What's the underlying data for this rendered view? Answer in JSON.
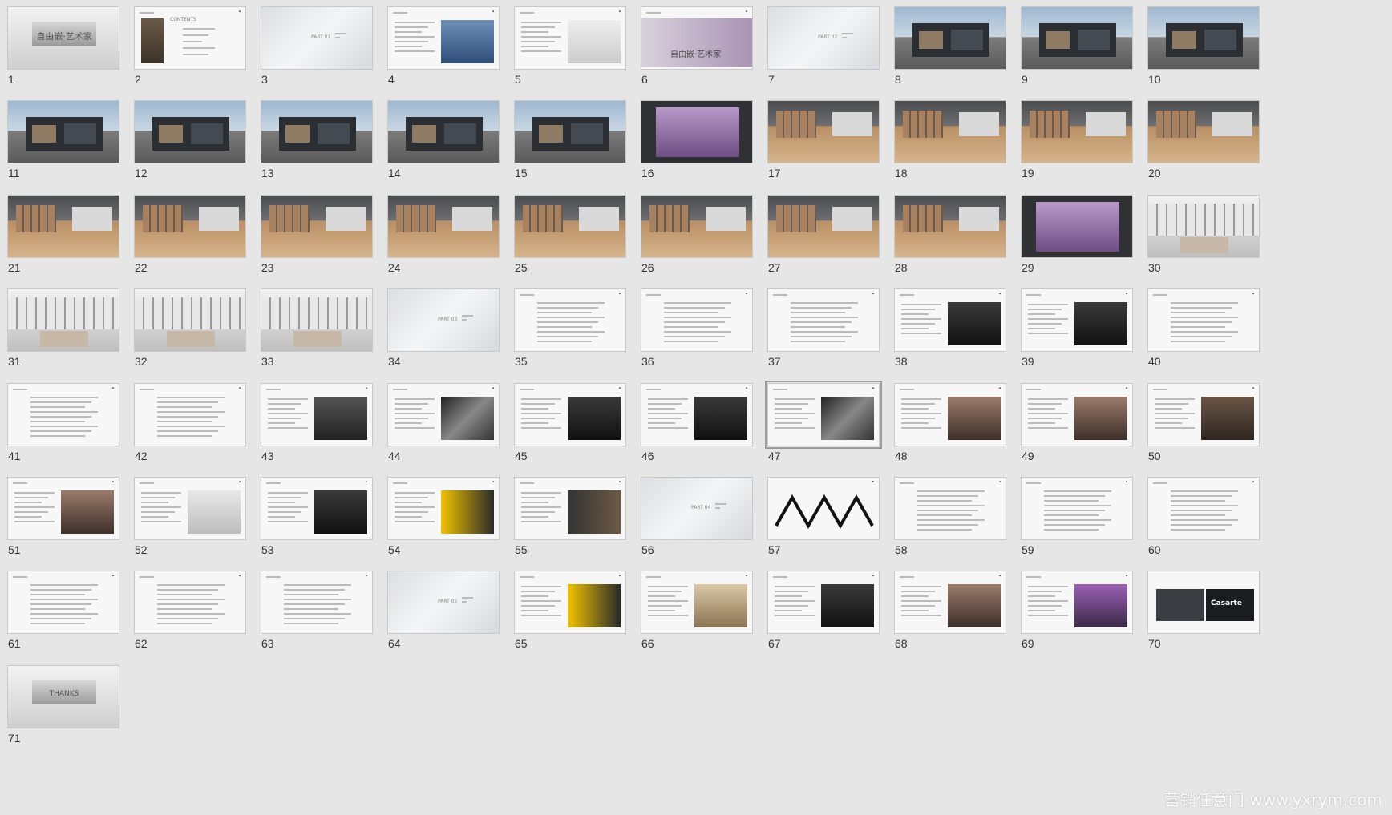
{
  "watermark": "营销任意门 www.yxrym.com",
  "colors": {
    "background": "#e6e6e6",
    "thumb_border": "#c8c8c8",
    "selected_border": "#9b9b9b"
  },
  "selected_slide": 47,
  "slides": [
    {
      "n": "1",
      "kind": "cover",
      "title": "自由嵌·艺术家"
    },
    {
      "n": "2",
      "kind": "contents",
      "title": "CONTENTS"
    },
    {
      "n": "3",
      "kind": "section",
      "title": "PART 01"
    },
    {
      "n": "4",
      "kind": "text-photo",
      "photo": "city"
    },
    {
      "n": "5",
      "kind": "text-photo",
      "photo": "plan"
    },
    {
      "n": "6",
      "kind": "banner",
      "title": "自由嵌·艺术家"
    },
    {
      "n": "7",
      "kind": "section",
      "title": "PART 02"
    },
    {
      "n": "8",
      "kind": "render",
      "scene": "dark"
    },
    {
      "n": "9",
      "kind": "render",
      "scene": "dark"
    },
    {
      "n": "10",
      "kind": "render",
      "scene": "dark"
    },
    {
      "n": "11",
      "kind": "render",
      "scene": "dark"
    },
    {
      "n": "12",
      "kind": "render",
      "scene": "dark"
    },
    {
      "n": "13",
      "kind": "render",
      "scene": "dark"
    },
    {
      "n": "14",
      "kind": "render",
      "scene": "dark"
    },
    {
      "n": "15",
      "kind": "render",
      "scene": "dark"
    },
    {
      "n": "16",
      "kind": "render",
      "scene": "purple"
    },
    {
      "n": "17",
      "kind": "render",
      "scene": "interior"
    },
    {
      "n": "18",
      "kind": "render",
      "scene": "interior"
    },
    {
      "n": "19",
      "kind": "render",
      "scene": "interior"
    },
    {
      "n": "20",
      "kind": "render",
      "scene": "interior"
    },
    {
      "n": "21",
      "kind": "render",
      "scene": "interior"
    },
    {
      "n": "22",
      "kind": "render",
      "scene": "interior"
    },
    {
      "n": "23",
      "kind": "render",
      "scene": "interior"
    },
    {
      "n": "24",
      "kind": "render",
      "scene": "interior"
    },
    {
      "n": "25",
      "kind": "render",
      "scene": "interior"
    },
    {
      "n": "26",
      "kind": "render",
      "scene": "interior"
    },
    {
      "n": "27",
      "kind": "render",
      "scene": "interior"
    },
    {
      "n": "28",
      "kind": "render",
      "scene": "interior"
    },
    {
      "n": "29",
      "kind": "render",
      "scene": "purple"
    },
    {
      "n": "30",
      "kind": "render",
      "scene": "light"
    },
    {
      "n": "31",
      "kind": "render",
      "scene": "light"
    },
    {
      "n": "32",
      "kind": "render",
      "scene": "light"
    },
    {
      "n": "33",
      "kind": "render",
      "scene": "light"
    },
    {
      "n": "34",
      "kind": "section",
      "title": "PART 03"
    },
    {
      "n": "35",
      "kind": "text"
    },
    {
      "n": "36",
      "kind": "text"
    },
    {
      "n": "37",
      "kind": "text"
    },
    {
      "n": "38",
      "kind": "text-photo",
      "photo": "dark"
    },
    {
      "n": "39",
      "kind": "text-photo",
      "photo": "dark"
    },
    {
      "n": "40",
      "kind": "text"
    },
    {
      "n": "41",
      "kind": "text"
    },
    {
      "n": "42",
      "kind": "text"
    },
    {
      "n": "43",
      "kind": "text-photo",
      "photo": "portraits"
    },
    {
      "n": "44",
      "kind": "text-photo",
      "photo": "collage"
    },
    {
      "n": "45",
      "kind": "text-photo",
      "photo": "dark"
    },
    {
      "n": "46",
      "kind": "text-photo",
      "photo": "dark"
    },
    {
      "n": "47",
      "kind": "text-photo",
      "photo": "collage"
    },
    {
      "n": "48",
      "kind": "text-photo",
      "photo": "people"
    },
    {
      "n": "49",
      "kind": "text-photo",
      "photo": "people"
    },
    {
      "n": "50",
      "kind": "text-photo",
      "photo": "interior"
    },
    {
      "n": "51",
      "kind": "text-photo",
      "photo": "people"
    },
    {
      "n": "52",
      "kind": "text-photo",
      "photo": "product"
    },
    {
      "n": "53",
      "kind": "text-photo",
      "photo": "dark"
    },
    {
      "n": "54",
      "kind": "text-photo",
      "photo": "yellow"
    },
    {
      "n": "55",
      "kind": "text-photo",
      "photo": "banner"
    },
    {
      "n": "56",
      "kind": "section",
      "title": "PART 04"
    },
    {
      "n": "57",
      "kind": "chart"
    },
    {
      "n": "58",
      "kind": "text"
    },
    {
      "n": "59",
      "kind": "text"
    },
    {
      "n": "60",
      "kind": "text"
    },
    {
      "n": "61",
      "kind": "text"
    },
    {
      "n": "62",
      "kind": "text"
    },
    {
      "n": "63",
      "kind": "text"
    },
    {
      "n": "64",
      "kind": "section",
      "title": "PART 05"
    },
    {
      "n": "65",
      "kind": "text-photo",
      "photo": "yellow"
    },
    {
      "n": "66",
      "kind": "text-photo",
      "photo": "food"
    },
    {
      "n": "67",
      "kind": "text-photo",
      "photo": "dark"
    },
    {
      "n": "68",
      "kind": "text-photo",
      "photo": "people"
    },
    {
      "n": "69",
      "kind": "text-photo",
      "photo": "flowers"
    },
    {
      "n": "70",
      "kind": "logo-slide",
      "title": "Casarte"
    },
    {
      "n": "71",
      "kind": "thanks",
      "title": "THANKS"
    }
  ]
}
